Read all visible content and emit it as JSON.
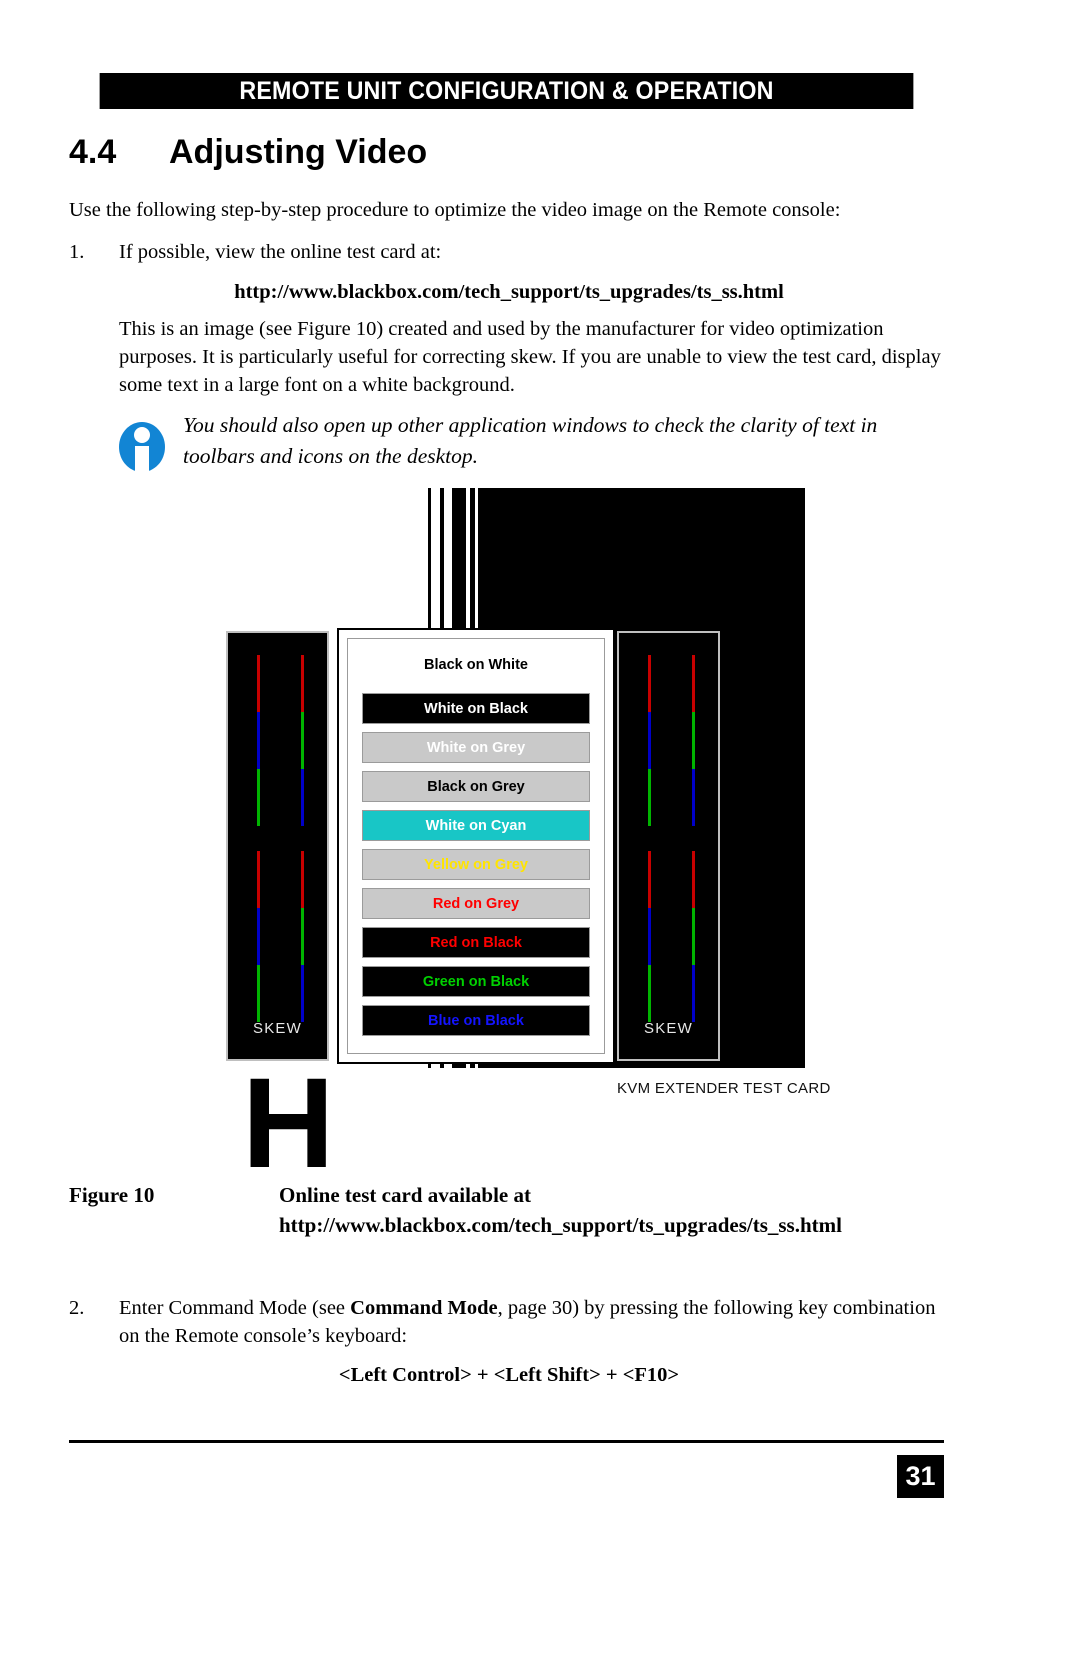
{
  "header": {
    "running_head": "REMOTE UNIT CONFIGURATION & OPERATION"
  },
  "section": {
    "number": "4.4",
    "title": "Adjusting Video"
  },
  "body": {
    "lead": "Use the following step-by-step procedure to optimize the video image on the Remote console:",
    "step1_num": "1.",
    "step1_text": "If possible, view the online test card at:",
    "url": "http://www.blackbox.com/tech_support/ts_upgrades/ts_ss.html",
    "paragraph1": "This is an image (see Figure 10) created and used by the manufacturer for video optimization purposes. It is particularly useful for correcting skew. If you are unable to view the test card, display some text in a large font on a white background.",
    "note_icon": "info-icon",
    "note_text": "You should also open up other application windows to check the clarity of text in toolbars and icons on the desktop.",
    "step2_num": "2.",
    "step2_text_a": "Enter Command Mode (see ",
    "step2_bold": "Command Mode",
    "step2_text_b": ", page 30) by pressing the following key combination on the Remote console’s keyboard:",
    "key_combination": "<Left Control> + <Left Shift> + <F10>"
  },
  "figure": {
    "caption_label": "Figure 10",
    "caption_title": "Online test card available at",
    "caption_url": "http://www.blackbox.com/tech_support/ts_upgrades/ts_ss.html",
    "kvm_label": "KVM EXTENDER TEST CARD",
    "big_letter": "H",
    "skew_label_left": "SKEW",
    "skew_label_right": "SKEW",
    "test_card_bars": [
      {
        "label": "Black on White",
        "bg": "#ffffff",
        "fg": "#000000",
        "style": "plain"
      },
      {
        "label": "White on Black",
        "bg": "#000000",
        "fg": "#ffffff",
        "style": "bordered"
      },
      {
        "label": "White on Grey",
        "bg": "#c9c9c9",
        "fg": "#ffffff",
        "style": "bordered"
      },
      {
        "label": "Black on Grey",
        "bg": "#c9c9c9",
        "fg": "#000000",
        "style": "bordered"
      },
      {
        "label": "White on Cyan",
        "bg": "#18c6c6",
        "fg": "#ffffff",
        "style": "bordered"
      },
      {
        "label": "Yellow on Grey",
        "bg": "#c9c9c9",
        "fg": "#ffe400",
        "style": "bordered"
      },
      {
        "label": "Red on Grey",
        "bg": "#c9c9c9",
        "fg": "#ff0000",
        "style": "bordered"
      },
      {
        "label": "Red on Black",
        "bg": "#000000",
        "fg": "#ff0000",
        "style": "bordered"
      },
      {
        "label": "Green on Black",
        "bg": "#000000",
        "fg": "#00d000",
        "style": "bordered"
      },
      {
        "label": "Blue on Black",
        "bg": "#000000",
        "fg": "#1414ff",
        "style": "bordered"
      }
    ],
    "skew_colors": {
      "red": "#c80000",
      "green": "#00b400",
      "blue": "#0000c8"
    }
  },
  "footer": {
    "page_number": "31"
  }
}
